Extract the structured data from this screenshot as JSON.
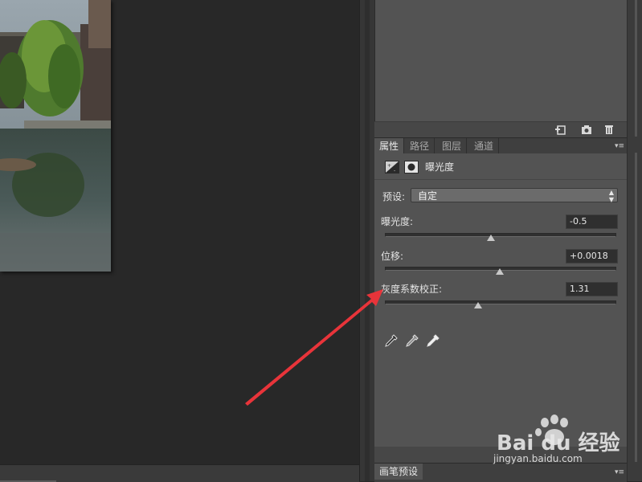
{
  "adjustments_panel": {
    "footer_icons": [
      "new-adjustment-icon",
      "camera-icon",
      "trash-icon"
    ]
  },
  "tabs": [
    {
      "label": "属性",
      "active": true
    },
    {
      "label": "路径",
      "active": false
    },
    {
      "label": "图层",
      "active": false
    },
    {
      "label": "通道",
      "active": false
    }
  ],
  "properties": {
    "title": "曝光度",
    "preset_label": "预设:",
    "preset_value": "自定",
    "exposure": {
      "label": "曝光度:",
      "value": "-0.5"
    },
    "offset": {
      "label": "位移:",
      "value": "+0.0018"
    },
    "gamma": {
      "label": "灰度系数校正:",
      "value": "1.31"
    },
    "eyedroppers": [
      "black-point-eyedropper-icon",
      "gray-point-eyedropper-icon",
      "white-point-eyedropper-icon"
    ]
  },
  "bottom_panel": {
    "tab_label": "画笔预设"
  },
  "watermark": {
    "brand": "Bai du 经验",
    "url": "jingyan.baidu.com"
  },
  "colors": {
    "panel_bg": "#535353",
    "canvas_bg": "#282828",
    "annotation_arrow": "#e8343a"
  }
}
